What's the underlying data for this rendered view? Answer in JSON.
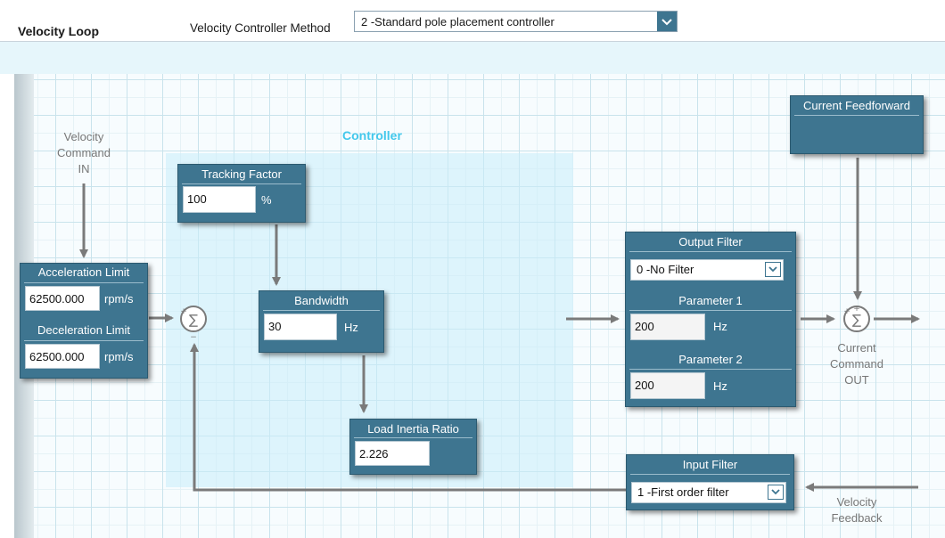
{
  "header": {
    "title": "Velocity Loop",
    "method_label": "Velocity Controller Method",
    "method_value": "2 -Standard pole placement controller"
  },
  "labels": {
    "controller": "Controller",
    "vel_cmd_l1": "Velocity",
    "vel_cmd_l2": "Command",
    "vel_cmd_l3": "IN",
    "cur_cmd_l1": "Current",
    "cur_cmd_l2": "Command",
    "cur_cmd_l3": "OUT",
    "vel_fb_l1": "Velocity",
    "vel_fb_l2": "Feedback"
  },
  "blocks": {
    "accel": {
      "title": "Acceleration Limit",
      "value": "62500.000",
      "unit": "rpm/s"
    },
    "decel": {
      "title": "Deceleration Limit",
      "value": "62500.000",
      "unit": "rpm/s"
    },
    "tracking": {
      "title": "Tracking Factor",
      "value": "100",
      "unit": "%"
    },
    "bandwidth": {
      "title": "Bandwidth",
      "value": "30",
      "unit": "Hz"
    },
    "inertia": {
      "title": "Load Inertia Ratio",
      "value": "2.226"
    },
    "current_ff": {
      "title": "Current Feedforward"
    },
    "output_filter": {
      "title": "Output Filter",
      "value": "0 -No Filter"
    },
    "param1": {
      "title": "Parameter 1",
      "value": "200",
      "unit": "Hz"
    },
    "param2": {
      "title": "Parameter 2",
      "value": "200",
      "unit": "Hz"
    },
    "input_filter": {
      "title": "Input Filter",
      "value": "1 -First order filter"
    }
  },
  "symbols": {
    "sigma": "∑",
    "plus": "+",
    "minus": "−"
  },
  "colors": {
    "block": "#3e7590",
    "accent": "#43c8ec",
    "arrow": "#7a7a7a"
  }
}
